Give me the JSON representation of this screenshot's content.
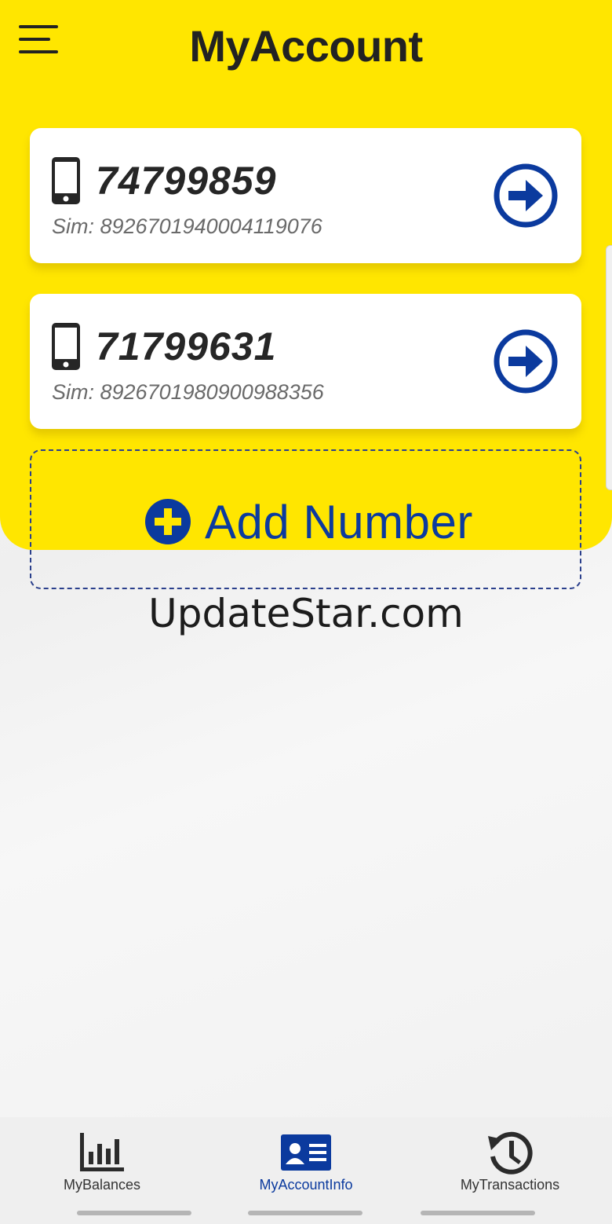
{
  "header": {
    "title": "MyAccount",
    "background_color": "#ffe600",
    "menu_icon": "hamburger-menu-icon"
  },
  "accounts": [
    {
      "number": "74799859",
      "sim": "Sim: 8926701940004119076",
      "icon": "phone-icon",
      "action_icon": "arrow-right-circle-icon"
    },
    {
      "number": "71799631",
      "sim": "Sim: 8926701980900988356",
      "icon": "phone-icon",
      "action_icon": "arrow-right-circle-icon"
    }
  ],
  "add_number": {
    "label": "Add Number",
    "icon": "plus-circle-icon",
    "accent_color": "#0b3a9e"
  },
  "watermark": "UpdateStar.com",
  "bottom_nav": {
    "items": [
      {
        "label": "MyBalances",
        "icon": "bar-chart-icon",
        "active": false
      },
      {
        "label": "MyAccountInfo",
        "icon": "account-card-icon",
        "active": true
      },
      {
        "label": "MyTransactions",
        "icon": "history-icon",
        "active": false
      }
    ]
  }
}
